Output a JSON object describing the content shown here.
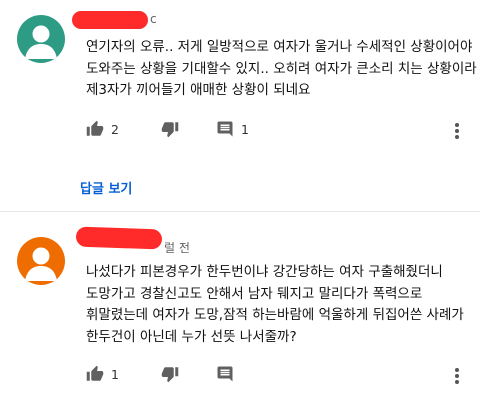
{
  "comments": [
    {
      "avatar_color": "#2e9c84",
      "meta_visible": "c",
      "lines": [
        "연기자의 오류.. 저게 일방적으로 여자가 울거나 수세적인 상황이어야",
        "도와주는 상황을 기대할수 있지.. 오히려 여자가 큰소리 치는 상황이라",
        "제3자가 끼어들기 애매한 상황이 되네요"
      ],
      "likes": "2",
      "replies_count": "1",
      "view_replies": "답글 보기"
    },
    {
      "avatar_color": "#ef6c00",
      "meta_visible": "럴 전",
      "lines": [
        "나섰다가 피본경우가 한두번이냐 강간당하는 여자 구출해줬더니",
        "도망가고 경찰신고도 안해서 남자 뒈지고 말리다가 폭력으로",
        "휘말렸는데 여자가 도망,잠적 하는바람에 억울하게 뒤집어쓴 사례가",
        "한두건이 아닌데 누가 선뜻 나서줄까?"
      ],
      "likes": "1"
    }
  ],
  "colors": {
    "redaction": "#ff2b2b",
    "link": "#065fd4"
  },
  "icons": [
    "thumb-up-icon",
    "thumb-down-icon",
    "reply-comment-icon",
    "more-vert-icon",
    "avatar-person-icon"
  ]
}
